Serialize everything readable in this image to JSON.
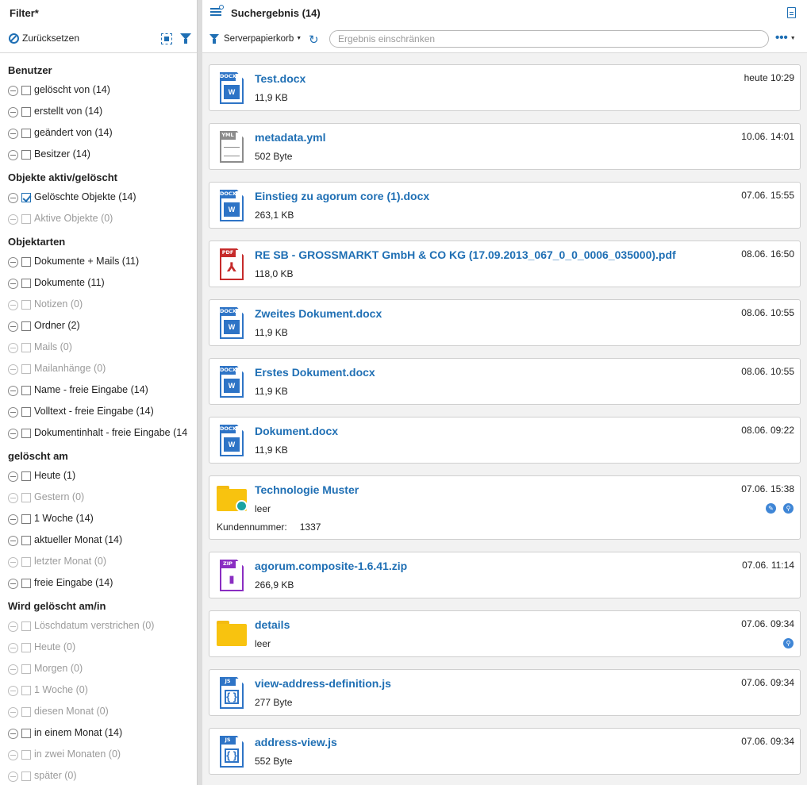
{
  "filter_panel": {
    "title": "Filter*",
    "reset_label": "Zurücksetzen",
    "groups": [
      {
        "title": "Benutzer",
        "items": [
          {
            "label": "gelöscht von (14)",
            "checked": false,
            "disabled": false
          },
          {
            "label": "erstellt von (14)",
            "checked": false,
            "disabled": false
          },
          {
            "label": "geändert von (14)",
            "checked": false,
            "disabled": false
          },
          {
            "label": "Besitzer (14)",
            "checked": false,
            "disabled": false
          }
        ]
      },
      {
        "title": "Objekte aktiv/gelöscht",
        "items": [
          {
            "label": "Gelöschte Objekte (14)",
            "checked": true,
            "disabled": false
          },
          {
            "label": "Aktive Objekte (0)",
            "checked": false,
            "disabled": true
          }
        ]
      },
      {
        "title": "Objektarten",
        "items": [
          {
            "label": "Dokumente + Mails (11)",
            "checked": false,
            "disabled": false
          },
          {
            "label": "Dokumente (11)",
            "checked": false,
            "disabled": false
          },
          {
            "label": "Notizen (0)",
            "checked": false,
            "disabled": true
          },
          {
            "label": "Ordner (2)",
            "checked": false,
            "disabled": false
          },
          {
            "label": "Mails (0)",
            "checked": false,
            "disabled": true
          },
          {
            "label": "Mailanhänge (0)",
            "checked": false,
            "disabled": true
          },
          {
            "label": "Name - freie Eingabe (14)",
            "checked": false,
            "disabled": false
          },
          {
            "label": "Volltext - freie Eingabe (14)",
            "checked": false,
            "disabled": false
          },
          {
            "label": "Dokumentinhalt - freie Eingabe (14",
            "checked": false,
            "disabled": false
          }
        ]
      },
      {
        "title": "gelöscht am",
        "items": [
          {
            "label": "Heute (1)",
            "checked": false,
            "disabled": false
          },
          {
            "label": "Gestern (0)",
            "checked": false,
            "disabled": true
          },
          {
            "label": "1 Woche (14)",
            "checked": false,
            "disabled": false
          },
          {
            "label": "aktueller Monat (14)",
            "checked": false,
            "disabled": false
          },
          {
            "label": "letzter Monat (0)",
            "checked": false,
            "disabled": true
          },
          {
            "label": "freie Eingabe (14)",
            "checked": false,
            "disabled": false
          }
        ]
      },
      {
        "title": "Wird gelöscht am/in",
        "items": [
          {
            "label": "Löschdatum verstrichen (0)",
            "checked": false,
            "disabled": true
          },
          {
            "label": "Heute (0)",
            "checked": false,
            "disabled": true
          },
          {
            "label": "Morgen (0)",
            "checked": false,
            "disabled": true
          },
          {
            "label": "1 Woche (0)",
            "checked": false,
            "disabled": true
          },
          {
            "label": "diesen Monat (0)",
            "checked": false,
            "disabled": true
          },
          {
            "label": "in einem Monat (14)",
            "checked": false,
            "disabled": false
          },
          {
            "label": "in zwei Monaten (0)",
            "checked": false,
            "disabled": true
          },
          {
            "label": "später (0)",
            "checked": false,
            "disabled": true
          }
        ]
      }
    ]
  },
  "results_panel": {
    "title": "Suchergebnis (14)",
    "source_label": "Serverpapierkorb",
    "search_placeholder": "Ergebnis einschränken",
    "more_label": "•••"
  },
  "results": [
    {
      "type": "docx",
      "tag": "DOCX",
      "glyph": "W",
      "name": "Test.docx",
      "size": "11,9 KB",
      "date": "heute 10:29"
    },
    {
      "type": "yml",
      "tag": "YML",
      "glyph": "",
      "name": "metadata.yml",
      "size": "502 Byte",
      "date": "10.06. 14:01"
    },
    {
      "type": "docx",
      "tag": "DOCX",
      "glyph": "W",
      "name": "Einstieg zu agorum core (1).docx",
      "size": "263,1 KB",
      "date": "07.06. 15:55"
    },
    {
      "type": "pdf",
      "tag": "PDF",
      "glyph": "⅄",
      "name": "RE SB - GROSSMARKT GmbH & CO KG (17.09.2013_067_0_0_0006_035000).pdf",
      "size": "118,0 KB",
      "date": "08.06. 16:50"
    },
    {
      "type": "docx",
      "tag": "DOCX",
      "glyph": "W",
      "name": "Zweites Dokument.docx",
      "size": "11,9 KB",
      "date": "08.06. 10:55"
    },
    {
      "type": "docx",
      "tag": "DOCX",
      "glyph": "W",
      "name": "Erstes Dokument.docx",
      "size": "11,9 KB",
      "date": "08.06. 10:55"
    },
    {
      "type": "docx",
      "tag": "DOCX",
      "glyph": "W",
      "name": "Dokument.docx",
      "size": "11,9 KB",
      "date": "08.06. 09:22"
    },
    {
      "type": "folder",
      "name": "Technologie Muster",
      "size": "leer",
      "date": "07.06. 15:38",
      "badge": true,
      "actions": [
        "edit",
        "search"
      ],
      "meta_key": "Kundennummer:",
      "meta_value": "1337"
    },
    {
      "type": "zip",
      "tag": "ZIP",
      "glyph": "▮",
      "name": "agorum.composite-1.6.41.zip",
      "size": "266,9 KB",
      "date": "07.06. 11:14"
    },
    {
      "type": "folder",
      "name": "details",
      "size": "leer",
      "date": "07.06. 09:34",
      "badge": false,
      "actions": [
        "search"
      ]
    },
    {
      "type": "js",
      "tag": "JS",
      "glyph": "{ }",
      "name": "view-address-definition.js",
      "size": "277 Byte",
      "date": "07.06. 09:34"
    },
    {
      "type": "js",
      "tag": "JS",
      "glyph": "{ }",
      "name": "address-view.js",
      "size": "552 Byte",
      "date": "07.06. 09:34"
    }
  ],
  "colors": {
    "accent": "#1f6fb4",
    "folder": "#f8c30f",
    "pdf": "#c62b2b",
    "zip": "#8a2ec2"
  }
}
